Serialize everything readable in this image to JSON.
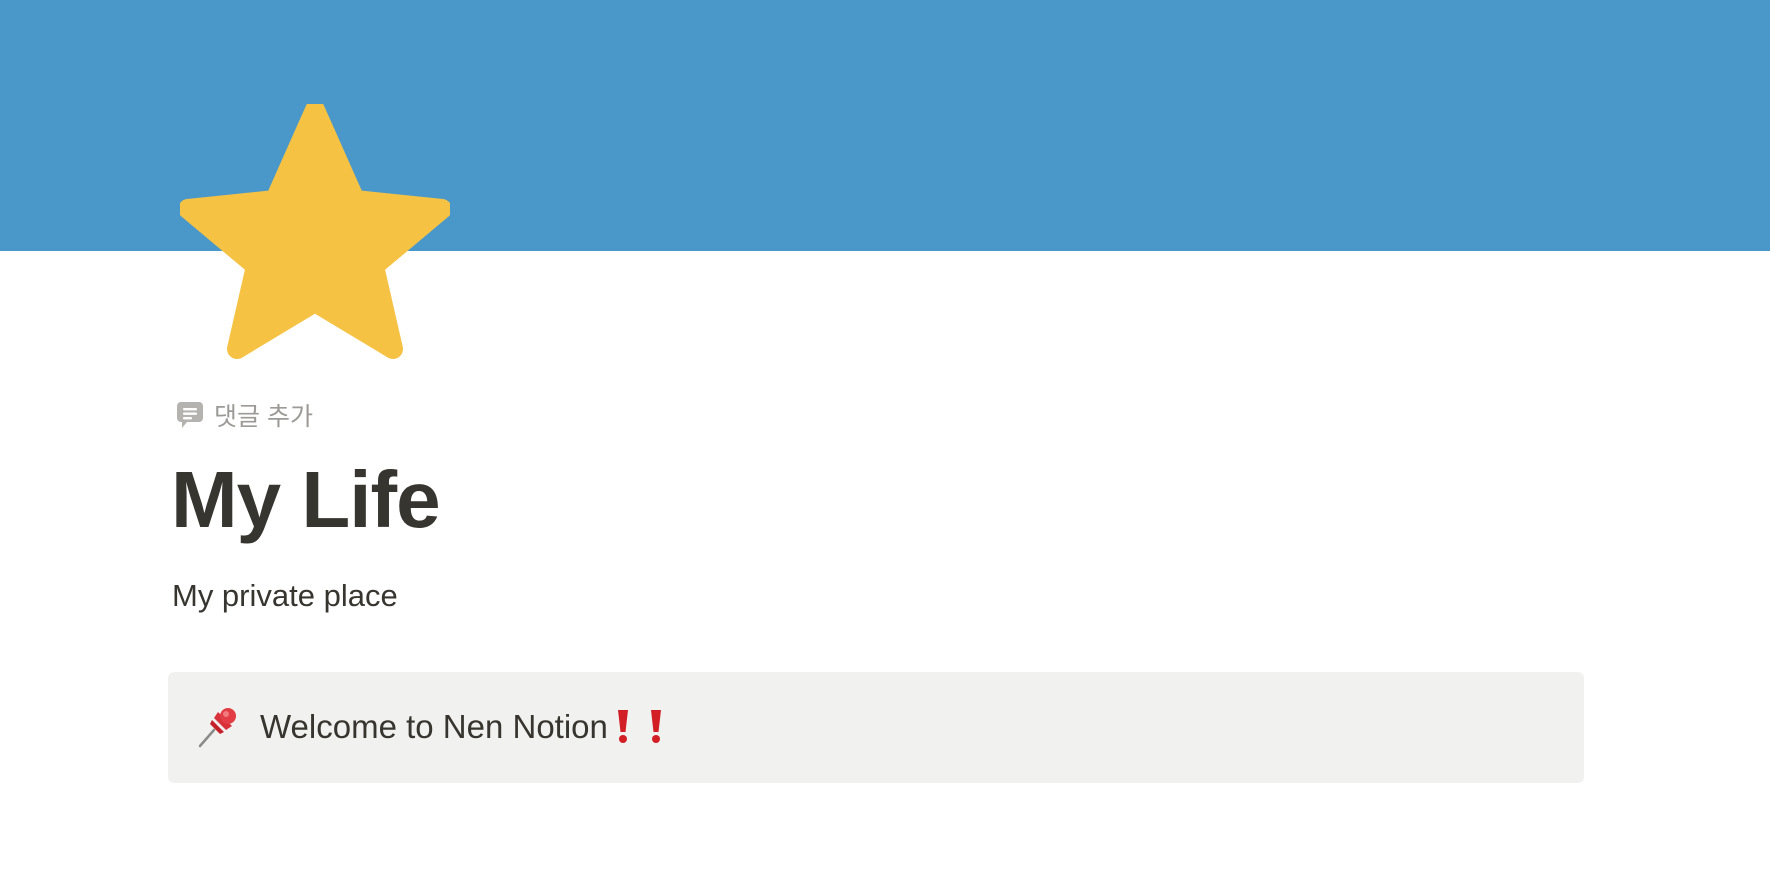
{
  "cover": {
    "color": "#4a98c9"
  },
  "page_icon": {
    "name": "star-icon",
    "color": "#f6c244"
  },
  "add_comment": {
    "label": "댓글 추가",
    "icon": "comment-icon",
    "color": "#9b9a97"
  },
  "title": "My Life",
  "subtitle": "My private place",
  "callout": {
    "icon": "pushpin-icon",
    "text": "Welcome to Nen Notion",
    "trailing_icons": [
      "exclamation-icon",
      "exclamation-icon"
    ],
    "background": "#f1f1ef"
  }
}
